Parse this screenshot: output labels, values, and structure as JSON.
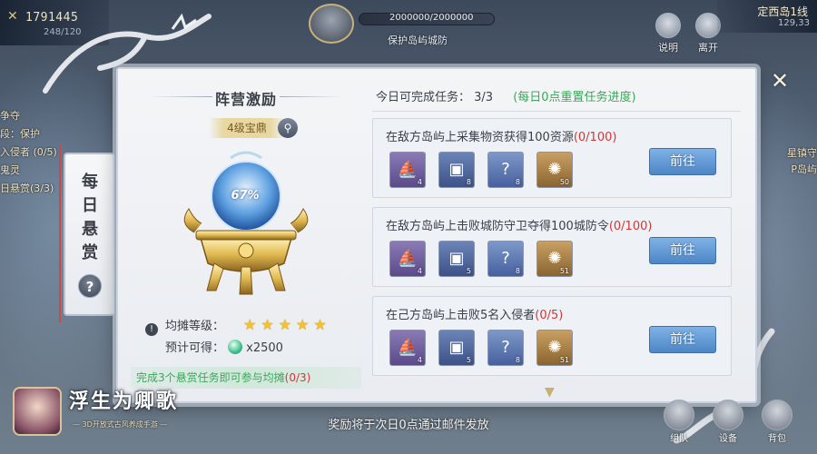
{
  "hud": {
    "power": "1791445",
    "sub": "248/120",
    "boss_hp": "2000000/2000000",
    "boss_name": "保护岛屿城防",
    "btn_explain": "说明",
    "btn_leave": "离开",
    "server_name": "定西岛1线",
    "server_coord": "129,33"
  },
  "left_strip": [
    "争夺",
    "段：保护",
    "入侵者 (0/5)",
    "鬼灵",
    "日悬赏(3/3)"
  ],
  "right_strip": [
    "星镇守",
    "P岛屿"
  ],
  "side_tab": {
    "text": "每日悬赏",
    "help": "?"
  },
  "left_panel": {
    "title": "阵营激励",
    "badge": "4级宝鼎",
    "percent": "67%",
    "level_label": "均摊等级：",
    "stars": 5,
    "expect_label": "预计可得：",
    "expect_value": "x2500",
    "footer_text": "完成3个悬赏任务即可参与均摊",
    "footer_progress": "(0/3)"
  },
  "right_panel": {
    "today_label": "今日可完成任务：",
    "today_count": "3/3",
    "reset_note": "(每日0点重置任务进度)",
    "tasks": [
      {
        "title": "在敌方岛屿上采集物资获得100资源",
        "progress": "(0/100)",
        "items": [
          {
            "icon": "ship-icon",
            "count": "4"
          },
          {
            "icon": "chest-icon",
            "count": "8"
          },
          {
            "icon": "mystery-icon",
            "count": "8"
          },
          {
            "icon": "swirl-icon",
            "count": "50"
          }
        ],
        "button": "前往"
      },
      {
        "title": "在敌方岛屿上击败城防守卫夺得100城防令",
        "progress": "(0/100)",
        "items": [
          {
            "icon": "ship-icon",
            "count": "4"
          },
          {
            "icon": "chest-icon",
            "count": "5"
          },
          {
            "icon": "mystery-icon",
            "count": "8"
          },
          {
            "icon": "swirl-icon",
            "count": "51"
          }
        ],
        "button": "前往"
      },
      {
        "title": "在己方岛屿上击败5名入侵者",
        "progress": "(0/5)",
        "items": [
          {
            "icon": "ship-icon",
            "count": "4"
          },
          {
            "icon": "chest-icon",
            "count": "5"
          },
          {
            "icon": "mystery-icon",
            "count": "8"
          },
          {
            "icon": "swirl-icon",
            "count": "51"
          }
        ],
        "button": "前往"
      }
    ]
  },
  "notice": "奖励将于次日0点通过邮件发放",
  "logo": {
    "title": "浮生为卿歌",
    "subtitle": "— 3D开放式古风养成手游 —"
  },
  "bottom_icons": [
    "组队",
    "设备",
    "背包"
  ],
  "colors": {
    "accent_blue": "#4d86c6",
    "progress_red": "#d33636",
    "note_green": "#3aa85a",
    "star_gold": "#f2c230"
  }
}
